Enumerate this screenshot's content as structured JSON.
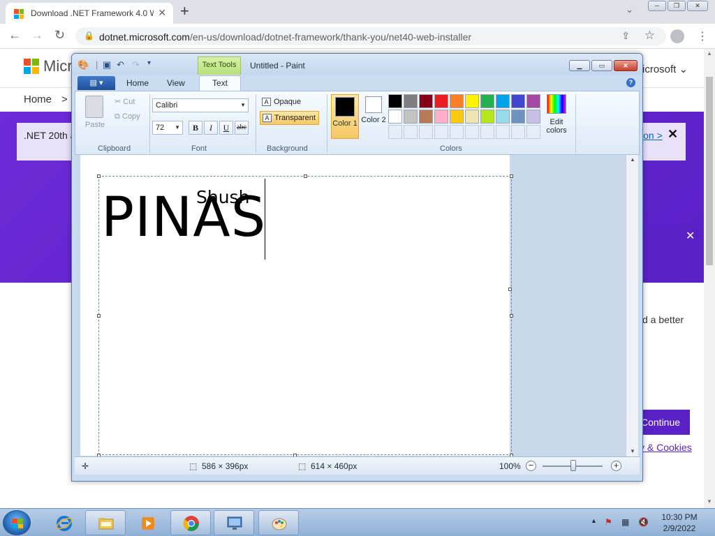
{
  "browser": {
    "tab_title": "Download .NET Framework 4.0 W",
    "new_tab": "+",
    "url_domain": "dotnet.microsoft.com",
    "url_path": "/en-us/download/dotnet-framework/thank-you/net40-web-installer",
    "window_buttons": [
      "─",
      "❐",
      "✕"
    ]
  },
  "page": {
    "brand": "Micr",
    "header_right": "icrosoft",
    "breadcrumb_home": "Home",
    "breadcrumb_sep": ">",
    "banner_text": ".NET 20th a",
    "banner_link": "ion >",
    "banner_close": "✕",
    "banner2_close": "✕",
    "side_text": "d a better",
    "continue_label": "Continue",
    "cookies_link": "y & Cookies"
  },
  "paint": {
    "text_tools_label": "Text Tools",
    "window_title": "Untitled - Paint",
    "tabs": {
      "home": "Home",
      "view": "View",
      "text": "Text"
    },
    "clipboard": {
      "paste": "Paste",
      "cut": "Cut",
      "copy": "Copy",
      "label": "Clipboard"
    },
    "font": {
      "family": "Calibri",
      "size": "72",
      "bold": "B",
      "italic": "I",
      "underline": "U",
      "strike": "abc",
      "label": "Font"
    },
    "background": {
      "opaque": "Opaque",
      "transparent": "Transparent",
      "label": "Background"
    },
    "colors": {
      "color1_label": "Color 1",
      "color2_label": "Color 2",
      "color1": "#000000",
      "color2": "#ffffff",
      "label": "Colors",
      "edit_label": "Edit colors",
      "palette_row1": [
        "#000000",
        "#7f7f7f",
        "#880015",
        "#ed1c24",
        "#ff7f27",
        "#fff200",
        "#22b14c",
        "#00a2e8",
        "#3f48cc",
        "#a349a4"
      ],
      "palette_row2": [
        "#ffffff",
        "#c3c3c3",
        "#b97a57",
        "#ffaec9",
        "#ffc90e",
        "#efe4b0",
        "#b5e61d",
        "#99d9ea",
        "#7092be",
        "#c8bfe7"
      ]
    },
    "canvas_text_big": "PINAS",
    "canvas_text_small": "Shush",
    "status": {
      "selection_size": "586 × 396px",
      "image_size": "614 × 460px",
      "zoom": "100%"
    }
  },
  "taskbar": {
    "time": "10:30 PM",
    "date": "2/9/2022"
  }
}
